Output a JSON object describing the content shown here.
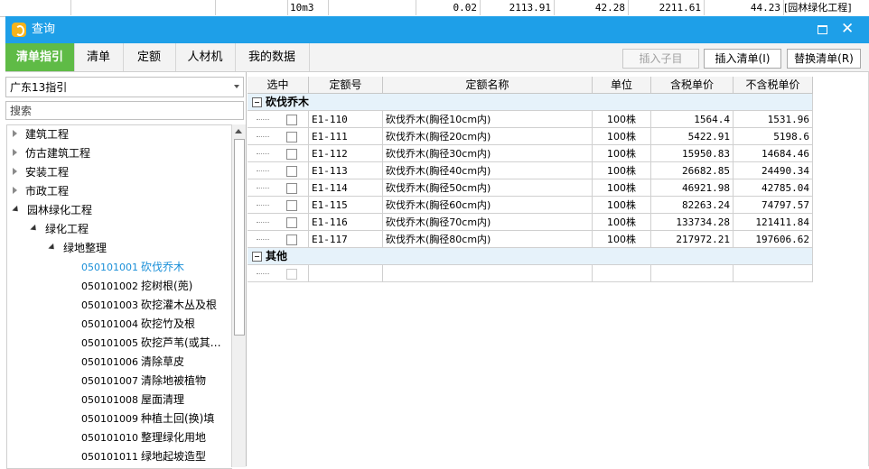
{
  "background_row": {
    "unit": "10m3",
    "qty": "0.02",
    "price1": "2113.91",
    "price2": "42.28",
    "price3": "2211.61",
    "price4": "44.23",
    "tag": "[园林绿化工程]"
  },
  "window": {
    "title": "查询",
    "accent": "#1e9fe8"
  },
  "tabs": [
    {
      "label": "清单指引",
      "active": true
    },
    {
      "label": "清单"
    },
    {
      "label": "定额"
    },
    {
      "label": "人材机"
    },
    {
      "label": "我的数据"
    }
  ],
  "toolbar": {
    "insert_child": "插入子目",
    "insert_list": "插入清单(I)",
    "replace_list": "替换清单(R)"
  },
  "guide_select": {
    "value": "广东13指引"
  },
  "search": {
    "placeholder": "搜索"
  },
  "tree": {
    "level0": [
      "建筑工程",
      "仿古建筑工程",
      "安装工程",
      "市政工程",
      "园林绿化工程"
    ],
    "level1": "绿化工程",
    "level2": "绿地整理",
    "leaves": [
      {
        "code": "050101001",
        "name": "砍伐乔木"
      },
      {
        "code": "050101002",
        "name": "挖树根(蔸)"
      },
      {
        "code": "050101003",
        "name": "砍挖灌木丛及根"
      },
      {
        "code": "050101004",
        "name": "砍挖竹及根"
      },
      {
        "code": "050101005",
        "name": "砍挖芦苇(或其…"
      },
      {
        "code": "050101006",
        "name": "清除草皮"
      },
      {
        "code": "050101007",
        "name": "清除地被植物"
      },
      {
        "code": "050101008",
        "name": "屋面清理"
      },
      {
        "code": "050101009",
        "name": "种植土回(换)填"
      },
      {
        "code": "050101010",
        "name": "整理绿化用地"
      },
      {
        "code": "050101011",
        "name": "绿地起坡造型"
      }
    ]
  },
  "grid": {
    "headers": [
      "选中",
      "定额号",
      "定额名称",
      "单位",
      "含税单价",
      "不含税单价"
    ],
    "groups": [
      {
        "label": "砍伐乔木",
        "rows": [
          {
            "code": "E1-110",
            "name": "砍伐乔木(胸径10cm内)",
            "unit": "100株",
            "tax_price": "1564.4",
            "notax_price": "1531.96"
          },
          {
            "code": "E1-111",
            "name": "砍伐乔木(胸径20cm内)",
            "unit": "100株",
            "tax_price": "5422.91",
            "notax_price": "5198.6"
          },
          {
            "code": "E1-112",
            "name": "砍伐乔木(胸径30cm内)",
            "unit": "100株",
            "tax_price": "15950.83",
            "notax_price": "14684.46"
          },
          {
            "code": "E1-113",
            "name": "砍伐乔木(胸径40cm内)",
            "unit": "100株",
            "tax_price": "26682.85",
            "notax_price": "24490.34"
          },
          {
            "code": "E1-114",
            "name": "砍伐乔木(胸径50cm内)",
            "unit": "100株",
            "tax_price": "46921.98",
            "notax_price": "42785.04"
          },
          {
            "code": "E1-115",
            "name": "砍伐乔木(胸径60cm内)",
            "unit": "100株",
            "tax_price": "82263.24",
            "notax_price": "74797.57"
          },
          {
            "code": "E1-116",
            "name": "砍伐乔木(胸径70cm内)",
            "unit": "100株",
            "tax_price": "133734.28",
            "notax_price": "121411.84"
          },
          {
            "code": "E1-117",
            "name": "砍伐乔木(胸径80cm内)",
            "unit": "100株",
            "tax_price": "217972.21",
            "notax_price": "197606.62"
          }
        ]
      },
      {
        "label": "其他",
        "rows": []
      }
    ]
  }
}
